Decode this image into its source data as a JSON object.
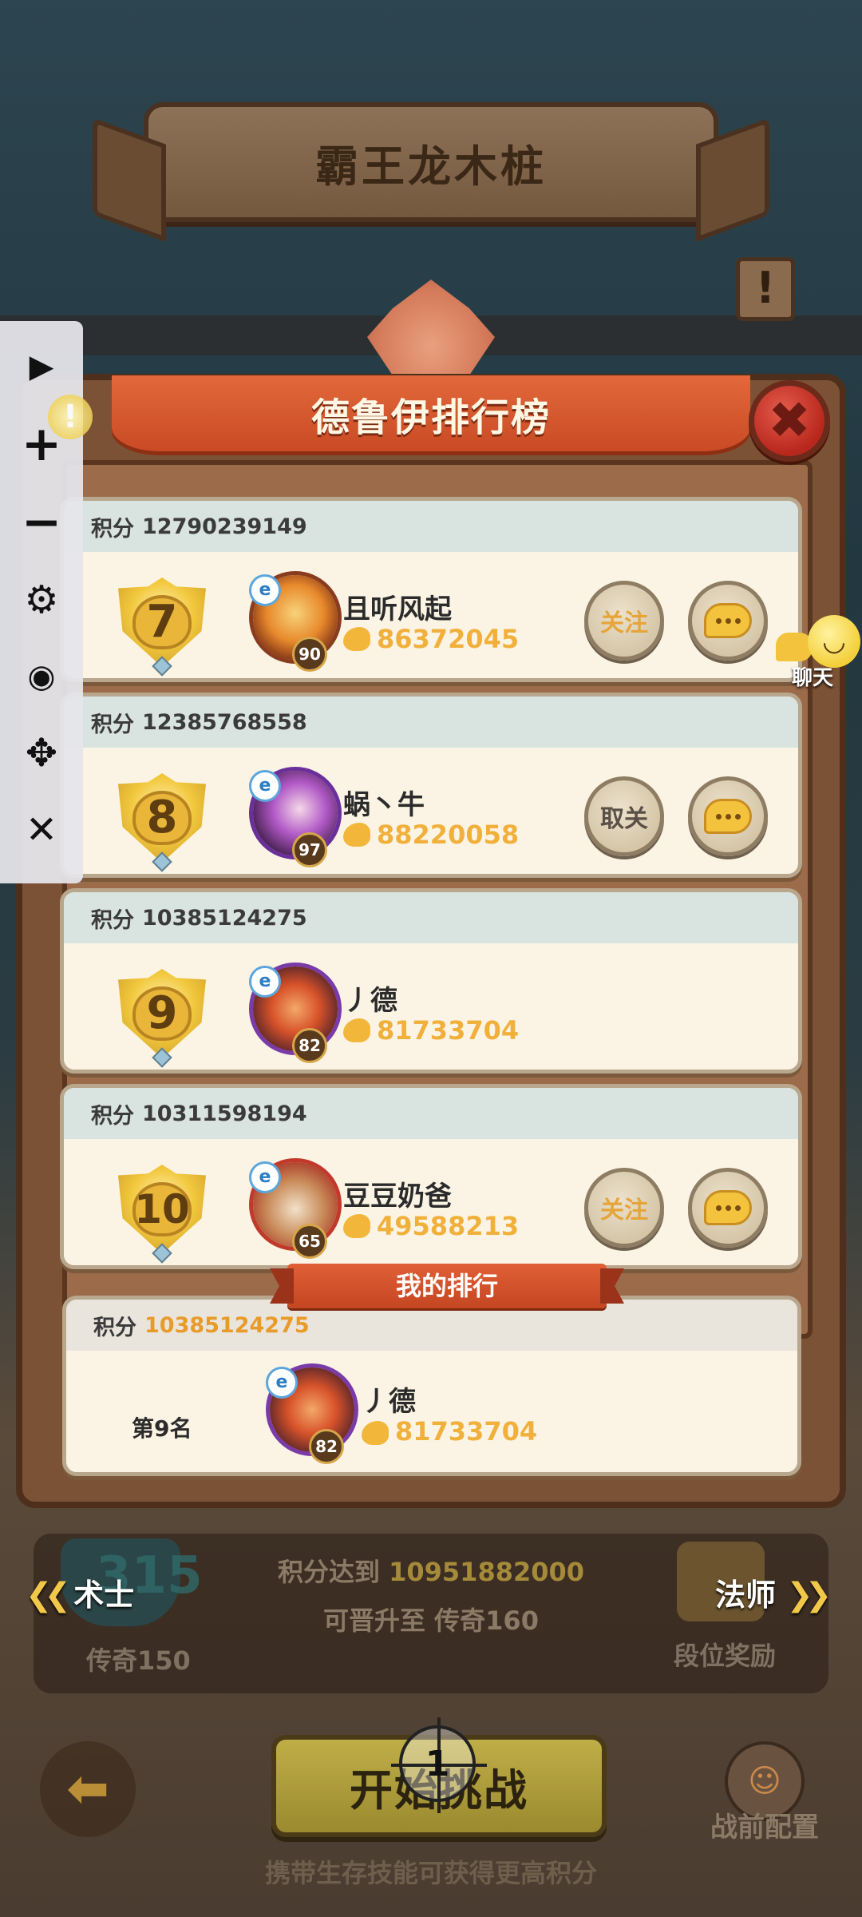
{
  "screen_title": "霸王龙木桩",
  "top_badge": "!",
  "panel": {
    "title": "德鲁伊排行榜",
    "close_symbol": "✖"
  },
  "entries": [
    {
      "score_label": "积分",
      "score": "12790239149",
      "rank": "7",
      "name": "且听风起",
      "level": "90",
      "power": "86372045",
      "follow_label": "关注",
      "follow_state": "follow"
    },
    {
      "score_label": "积分",
      "score": "12385768558",
      "rank": "8",
      "name": "蜗丶牛",
      "level": "97",
      "power": "88220058",
      "follow_label": "取关",
      "follow_state": "unfollow"
    },
    {
      "score_label": "积分",
      "score": "10385124275",
      "rank": "9",
      "name": "丿德",
      "level": "82",
      "power": "81733704",
      "follow_label": "",
      "follow_state": "self"
    },
    {
      "score_label": "积分",
      "score": "10311598194",
      "rank": "10",
      "name": "豆豆奶爸",
      "level": "65",
      "power": "49588213",
      "follow_label": "关注",
      "follow_state": "follow"
    }
  ],
  "my_ranking": {
    "header": "我的排行",
    "score_label": "积分",
    "score": "10385124275",
    "rank_text": "第9名",
    "name": "丿德",
    "level": "82",
    "power": "81733704"
  },
  "side_chat": {
    "label": "聊天"
  },
  "promotion": {
    "line1_prefix": "积分达到",
    "line1_value": "10951882000",
    "line2": "可晋升至 传奇160",
    "left_tier_num": "315",
    "left_tier_name": "传奇150",
    "right_label": "段位奖励"
  },
  "nav": {
    "prev_class": "术士",
    "next_class": "法师"
  },
  "bottom": {
    "start_label": "开始挑战",
    "prebattle_label": "战前配置",
    "tip": "携带生存技能可获得更高积分",
    "target_number": "1"
  },
  "toolbar": {
    "play": "▶",
    "zoom_in": "+",
    "zoom_out": "−",
    "settings": "⚙",
    "hide": "◉",
    "move": "✥",
    "close": "✕"
  },
  "colors": {
    "score_gold": "#f1b03c",
    "ribbon_red": "#d4552c",
    "panel_wood": "#7c5236"
  }
}
